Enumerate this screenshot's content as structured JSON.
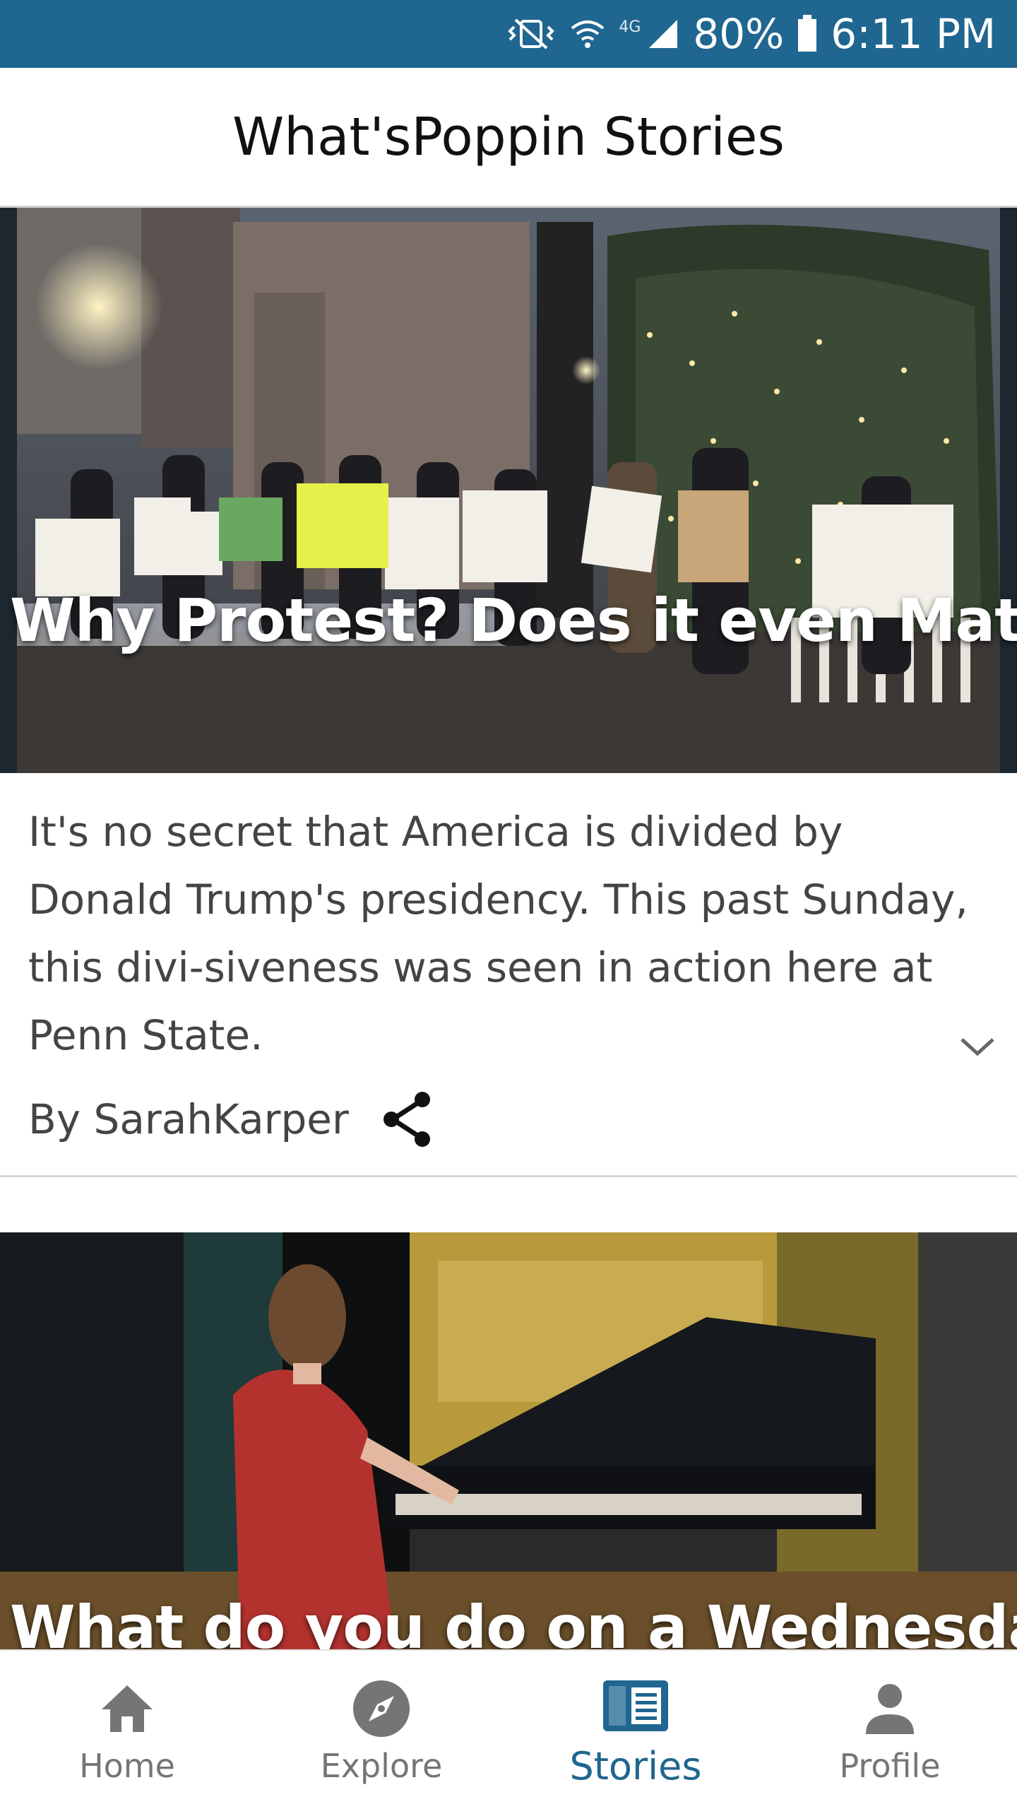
{
  "status_bar": {
    "network": "4G",
    "battery": "80%",
    "time": "6:11 PM"
  },
  "header": {
    "title": "What'sPoppin Stories"
  },
  "stories": [
    {
      "title": "Why Protest? Does it even Matter?",
      "excerpt": "It's no secret that America is divided by Donald Trump's presidency. This past Sunday, this divi-siveness was seen in action here at Penn State.",
      "author": "By SarahKarper"
    },
    {
      "title": "What do you do on a Wednesday"
    }
  ],
  "bottom_nav": {
    "items": [
      {
        "label": "Home",
        "icon": "home-icon"
      },
      {
        "label": "Explore",
        "icon": "compass-icon"
      },
      {
        "label": "Stories",
        "icon": "stories-icon",
        "active": true
      },
      {
        "label": "Profile",
        "icon": "person-icon"
      }
    ]
  },
  "colors": {
    "brand": "#1f6690",
    "inactive": "#757575"
  }
}
